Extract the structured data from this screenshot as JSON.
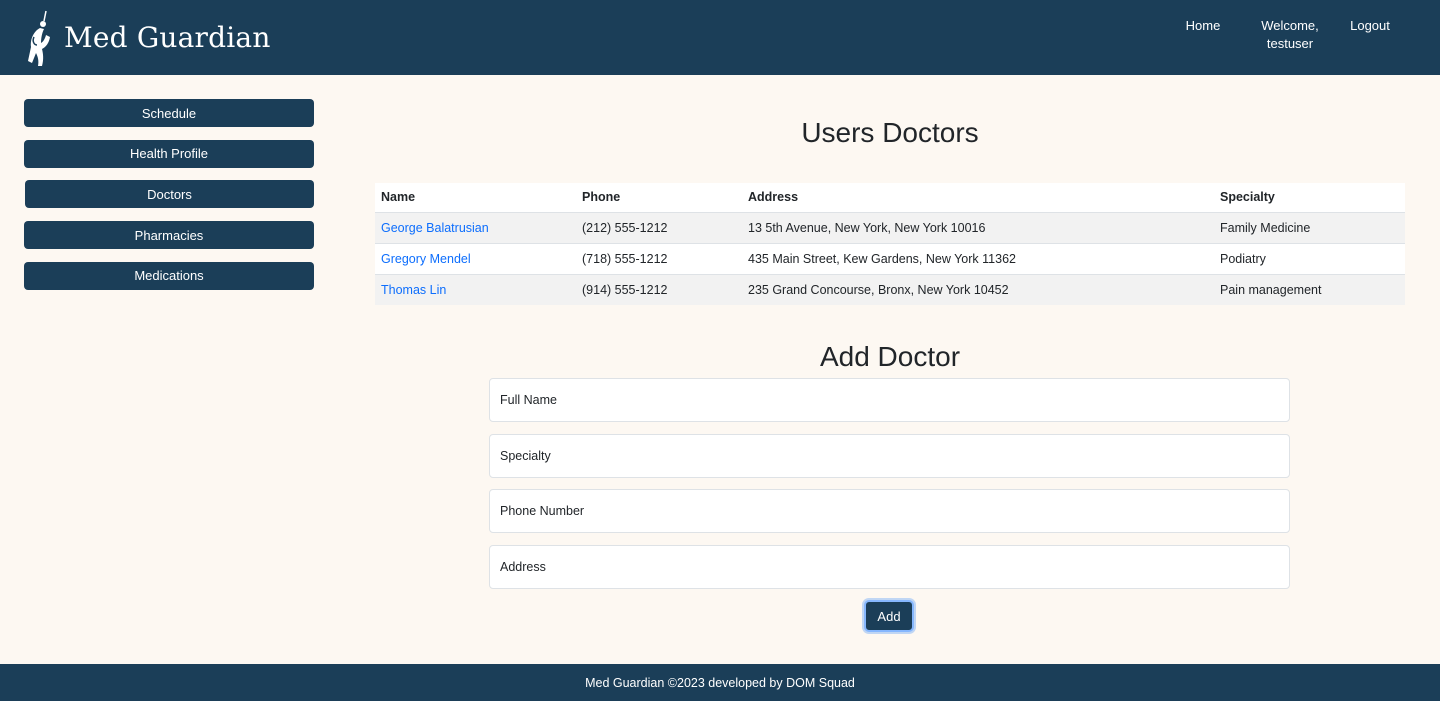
{
  "header": {
    "brand": "Med Guardian",
    "nav": {
      "home": "Home",
      "welcome": "Welcome,",
      "username": "testuser",
      "logout": "Logout"
    }
  },
  "sidebar": {
    "items": [
      {
        "label": "Schedule"
      },
      {
        "label": "Health Profile"
      },
      {
        "label": "Doctors"
      },
      {
        "label": "Pharmacies"
      },
      {
        "label": "Medications"
      }
    ]
  },
  "main": {
    "title": "Users Doctors",
    "table": {
      "headers": [
        "Name",
        "Phone",
        "Address",
        "Specialty"
      ],
      "rows": [
        [
          "George Balatrusian",
          "(212) 555-1212",
          "13 5th Avenue, New York, New York 10016",
          "Family Medicine"
        ],
        [
          "Gregory Mendel",
          "(718) 555-1212",
          "435 Main Street, Kew Gardens, New York 11362",
          "Podiatry"
        ],
        [
          "Thomas Lin",
          "(914) 555-1212",
          "235 Grand Concourse, Bronx, New York 10452",
          "Pain management"
        ]
      ]
    },
    "form": {
      "title": "Add Doctor",
      "placeholders": [
        "Full Name",
        "Specialty",
        "Phone Number",
        "Address"
      ],
      "submit_label": "Add"
    }
  },
  "footer": {
    "text": "Med Guardian ©2023 developed by DOM Squad"
  },
  "colors": {
    "primary": "#1b3e58",
    "background": "#fdf8f2",
    "link": "#0d6efd"
  },
  "icons": {
    "logo": "guardian-figure-icon"
  }
}
